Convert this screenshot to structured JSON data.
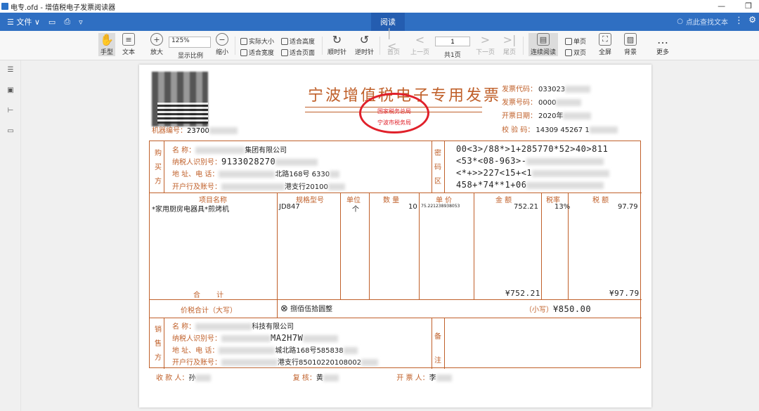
{
  "window": {
    "title": "电专.ofd - 增值税电子发票阅读器"
  },
  "menubar": {
    "file": "☰ 文件 ∨",
    "read_tab": "阅读",
    "search_placeholder": "点此查找文本"
  },
  "toolbar": {
    "hand": "手型",
    "text": "文本",
    "zoom_in": "放大",
    "zoom_value": "125%",
    "zoom_label": "显示比例",
    "zoom_out": "缩小",
    "actual_size": "实际大小",
    "fit_height": "适合高度",
    "fit_width": "适合宽度",
    "fit_page": "适合页面",
    "rotate_cw": "顺时针",
    "rotate_ccw": "逆时针",
    "first": "首页",
    "prev": "上一页",
    "page_input": "1",
    "total": "共1页",
    "next": "下一页",
    "last": "尾页",
    "continuous": "连续阅读",
    "single": "单页",
    "double": "双页",
    "fullscreen": "全屏",
    "background": "背景",
    "more": "更多"
  },
  "invoice": {
    "title": "宁波增值税电子专用发票",
    "seal_top": "国家税务总局",
    "seal_bottom": "宁波市税务局",
    "machine_no_label": "机器编号：",
    "machine_no": "23700",
    "code_label": "发票代码：",
    "code": "033023",
    "number_label": "发票号码：",
    "number": "0000",
    "date_label": "开票日期：",
    "date": "2020年",
    "check_label": "校 验 码：",
    "check": "14309 45267 1",
    "buyer_label": [
      "购",
      "买",
      "方"
    ],
    "f_name": "名 称：",
    "f_tax": "纳税人识别号：",
    "f_addr": "地 址、电 话：",
    "f_bank": "开户行及账号：",
    "buyer": {
      "name": "集团有限公司",
      "tax_id": "9133028270",
      "addr": "北路168号 6330",
      "bank": "港支行20100"
    },
    "cipher_label": [
      "密",
      "码",
      "区"
    ],
    "cipher": [
      "00<3>/88*>1+285770*52>40>811",
      "<53*<08-963>-",
      "<*+>>227<15+<1",
      "458+*74**1+06"
    ],
    "col_item": "项目名称",
    "col_spec": "规格型号",
    "col_unit": "单位",
    "col_qty": "数 量",
    "col_price": "单 价",
    "col_amount": "金 额",
    "col_rate": "税率",
    "col_tax": "税 额",
    "item": {
      "name": "*家用厨房电器具*煎烤机",
      "spec": "JD847",
      "unit": "个",
      "qty": "10",
      "price": "75.221238938053",
      "amount": "752.21",
      "rate": "13%",
      "tax": "97.79"
    },
    "total_label": "合 计",
    "total_amount": "¥752.21",
    "total_tax": "¥97.79",
    "sum_label": "价税合计（大写）",
    "sum_upper": "捌佰伍拾圆整",
    "sum_lower_label": "（小写）",
    "sum_lower": "¥850.00",
    "seller_label": [
      "销",
      "售",
      "方"
    ],
    "seller": {
      "name": "科技有限公司",
      "tax_id": "MA2H7W",
      "addr": "城北路168号585838",
      "bank": "港支行85010220108002"
    },
    "note_label": [
      "备",
      "注"
    ],
    "payee_label": "收 款 人：",
    "payee": "孙",
    "reviewer_label": "复 核：",
    "reviewer": "黄",
    "issuer_label": "开 票 人：",
    "issuer": "李"
  }
}
